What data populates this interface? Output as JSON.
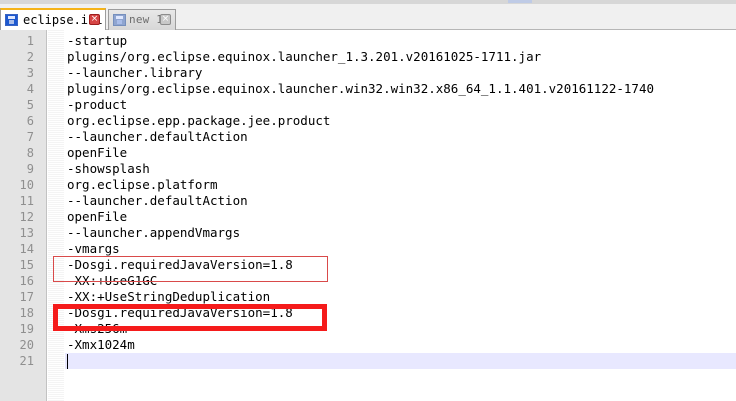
{
  "tabs": [
    {
      "label": "eclipse.ini",
      "active": true,
      "icon": "save-icon",
      "close_symbol": "×"
    },
    {
      "label": "new 1",
      "active": false,
      "icon": "save-icon",
      "close_symbol": "×"
    }
  ],
  "editor": {
    "current_line": 21,
    "lines": [
      {
        "number": "1",
        "text": "-startup"
      },
      {
        "number": "2",
        "text": "plugins/org.eclipse.equinox.launcher_1.3.201.v20161025-1711.jar"
      },
      {
        "number": "3",
        "text": "--launcher.library"
      },
      {
        "number": "4",
        "text": "plugins/org.eclipse.equinox.launcher.win32.win32.x86_64_1.1.401.v20161122-1740"
      },
      {
        "number": "5",
        "text": "-product"
      },
      {
        "number": "6",
        "text": "org.eclipse.epp.package.jee.product"
      },
      {
        "number": "7",
        "text": "--launcher.defaultAction"
      },
      {
        "number": "8",
        "text": "openFile"
      },
      {
        "number": "9",
        "text": "-showsplash"
      },
      {
        "number": "10",
        "text": "org.eclipse.platform"
      },
      {
        "number": "11",
        "text": "--launcher.defaultAction"
      },
      {
        "number": "12",
        "text": "openFile"
      },
      {
        "number": "13",
        "text": "--launcher.appendVmargs"
      },
      {
        "number": "14",
        "text": "-vmargs"
      },
      {
        "number": "15",
        "text": "-Dosgi.requiredJavaVersion=1.8"
      },
      {
        "number": "16",
        "text": "-XX:+UseG1GC"
      },
      {
        "number": "17",
        "text": "-XX:+UseStringDeduplication"
      },
      {
        "number": "18",
        "text": "-Dosgi.requiredJavaVersion=1.8"
      },
      {
        "number": "19",
        "text": "-Xms256m"
      },
      {
        "number": "20",
        "text": "-Xmx1024m"
      },
      {
        "number": "21",
        "text": ""
      }
    ]
  },
  "colors": {
    "accent_tab": "#f5b318",
    "editor_background": "#ffffff",
    "gutter_background": "#e4e4e4",
    "current_line": "#e8e8ff",
    "annotation_red": "#f51b1b"
  }
}
